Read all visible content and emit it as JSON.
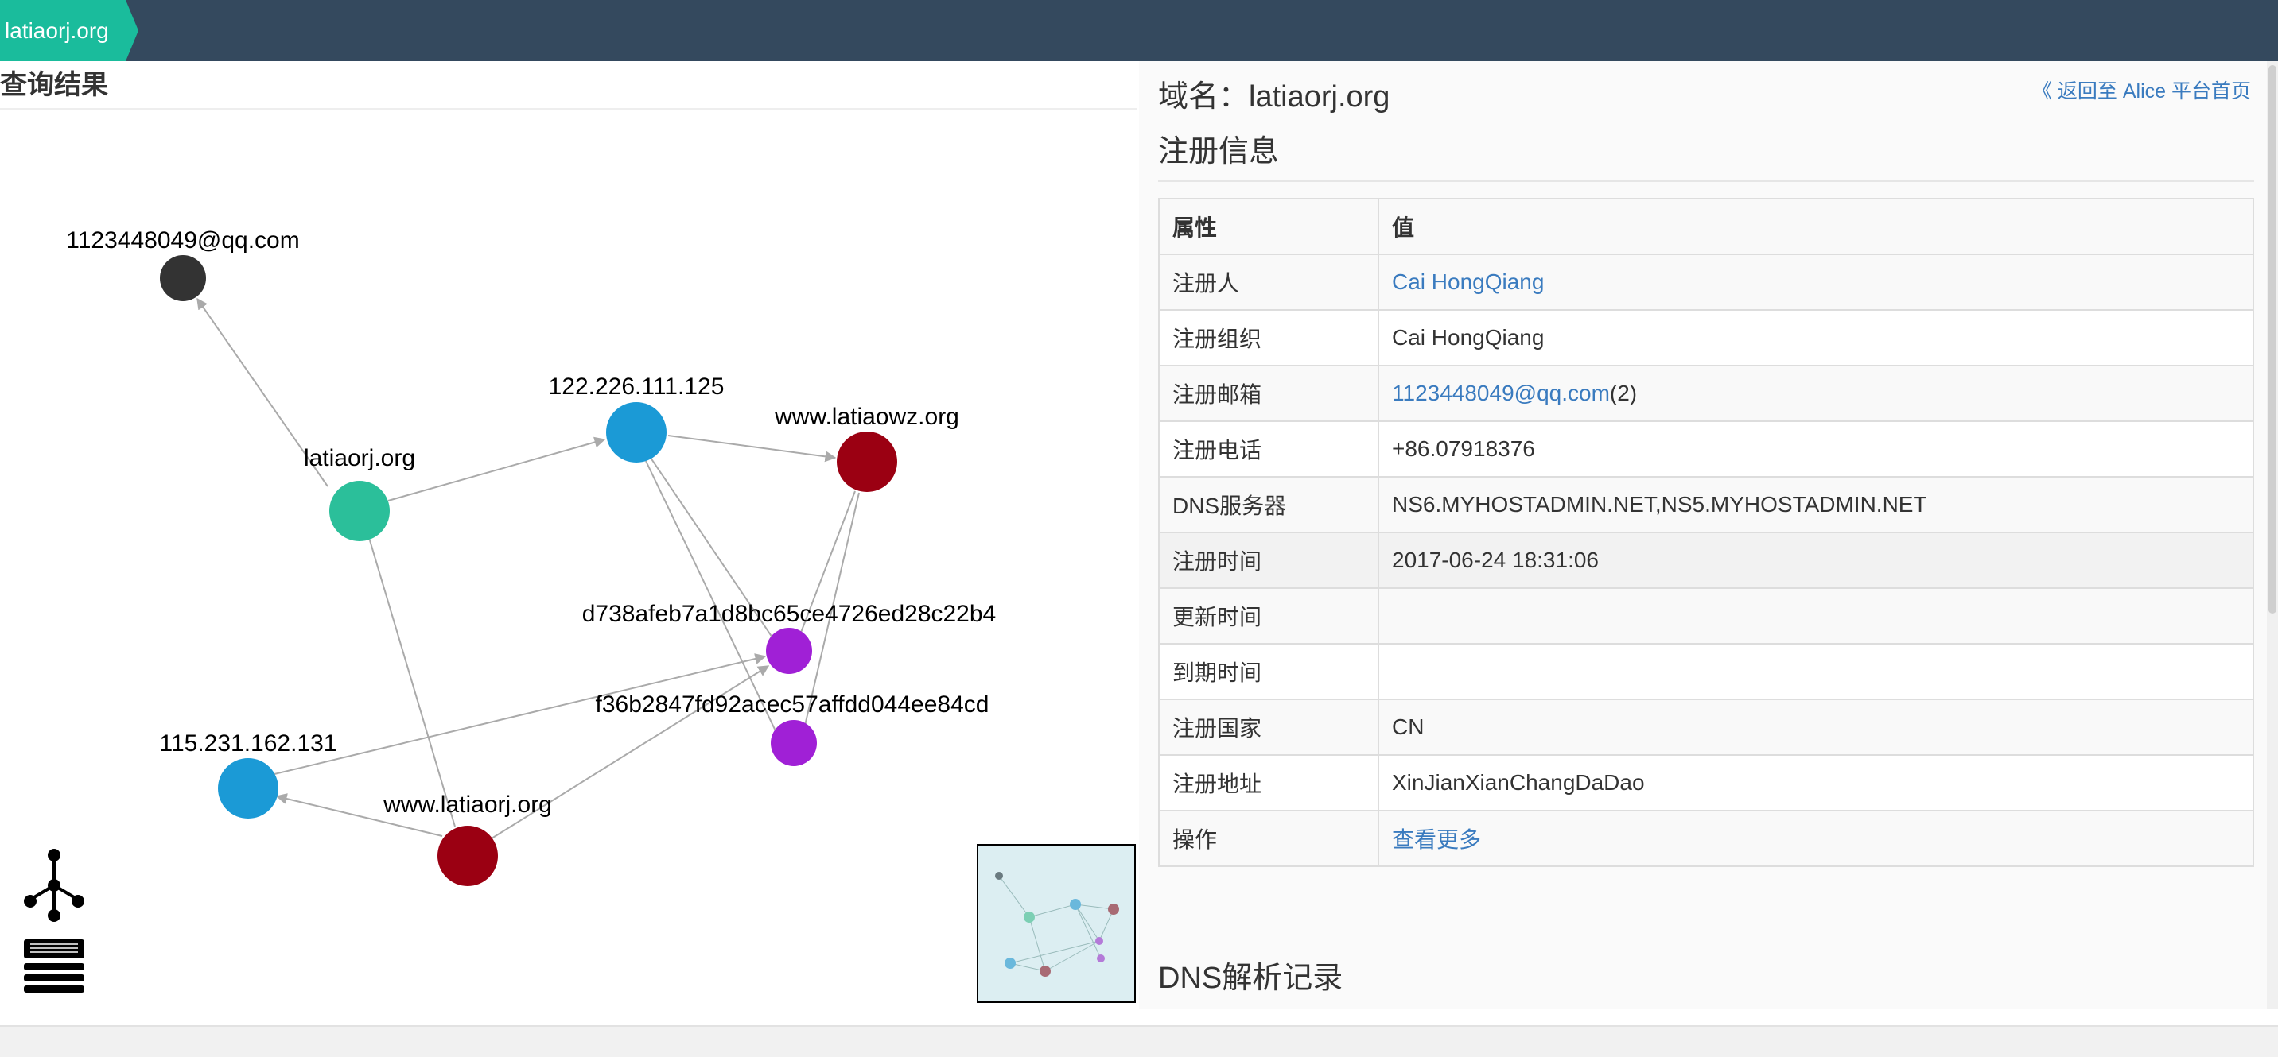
{
  "header": {
    "domain_tab": "latiaorj.org"
  },
  "left": {
    "title": "查询结果"
  },
  "graph": {
    "nodes": [
      {
        "id": "email",
        "label": "1123448049@qq.com",
        "color": "#333333"
      },
      {
        "id": "latiaorj",
        "label": "latiaorj.org",
        "color": "#2bbf9a"
      },
      {
        "id": "ip1",
        "label": "122.226.111.125",
        "color": "#1b9ad6"
      },
      {
        "id": "latiaowz",
        "label": "www.latiaowz.org",
        "color": "#9b0012"
      },
      {
        "id": "hash1",
        "label": "d738afeb7a1d8bc65ce4726ed28c22b4",
        "color": "#a020d6"
      },
      {
        "id": "hash2",
        "label": "f36b2847fd92acec57affdd044ee84cd",
        "color": "#a020d6"
      },
      {
        "id": "ip2",
        "label": "115.231.162.131",
        "color": "#1b9ad6"
      },
      {
        "id": "wwwlatiaorj",
        "label": "www.latiaorj.org",
        "color": "#9b0012"
      }
    ],
    "edge_color": "#aaaaaa"
  },
  "tools": {
    "layout_icon": "network-tree-icon",
    "list_icon": "list-view-icon"
  },
  "right": {
    "domain_heading": "域名：latiaorj.org",
    "back_link": "《 返回至 Alice 平台首页",
    "reg_section_title": "注册信息",
    "table": {
      "headers": [
        "属性",
        "值"
      ],
      "rows": [
        {
          "attr": "注册人",
          "value": "Cai HongQiang",
          "is_link": true
        },
        {
          "attr": "注册组织",
          "value": "Cai HongQiang"
        },
        {
          "attr": "注册邮箱",
          "value": "1123448049@qq.com",
          "is_link": true,
          "suffix": "(2)"
        },
        {
          "attr": "注册电话",
          "value": "+86.07918376"
        },
        {
          "attr": "DNS服务器",
          "value": "NS6.MYHOSTADMIN.NET,NS5.MYHOSTADMIN.NET"
        },
        {
          "attr": "注册时间",
          "value": "2017-06-24 18:31:06"
        },
        {
          "attr": "更新时间",
          "value": ""
        },
        {
          "attr": "到期时间",
          "value": ""
        },
        {
          "attr": "注册国家",
          "value": "CN"
        },
        {
          "attr": "注册地址",
          "value": "XinJianXianChangDaDao"
        },
        {
          "attr": "操作",
          "value": "查看更多",
          "is_link": true
        }
      ]
    },
    "dns_section_title": "DNS解析记录"
  }
}
